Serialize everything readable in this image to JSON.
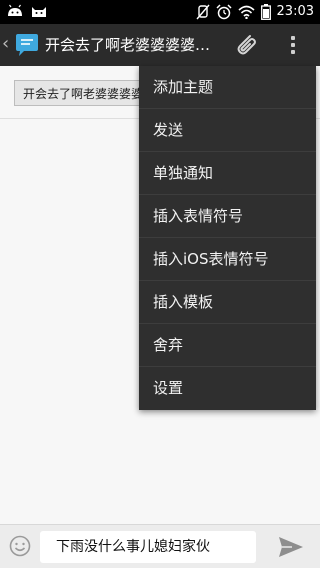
{
  "status_bar": {
    "time": "23:03",
    "left_icons": [
      "android-icon",
      "cat-icon"
    ],
    "right_icons": [
      "silent-icon",
      "alarm-icon",
      "wifi-icon",
      "battery-icon"
    ]
  },
  "action_bar": {
    "title": "开会去了啊老婆婆婆婆…",
    "back_icon": "chevron-left-icon",
    "app_icon": "message-icon",
    "attach_icon": "paperclip-icon",
    "overflow_icon": "overflow-menu-icon"
  },
  "content": {
    "recipient_chip": "开会去了啊老婆婆婆婆"
  },
  "menu": {
    "items": [
      {
        "label": "添加主题"
      },
      {
        "label": "发送"
      },
      {
        "label": "单独通知"
      },
      {
        "label": "插入表情符号"
      },
      {
        "label": "插入iOS表情符号"
      },
      {
        "label": "插入模板"
      },
      {
        "label": "舍弃"
      },
      {
        "label": "设置"
      }
    ]
  },
  "compose": {
    "value": "下雨没什么事儿媳妇家伙",
    "emoji_icon": "smiley-icon",
    "send_icon": "send-icon"
  },
  "colors": {
    "action_bar_bg": "#2b2b2b",
    "menu_bg": "#2f2f2f",
    "app_icon_blue": "#3fa9df"
  }
}
